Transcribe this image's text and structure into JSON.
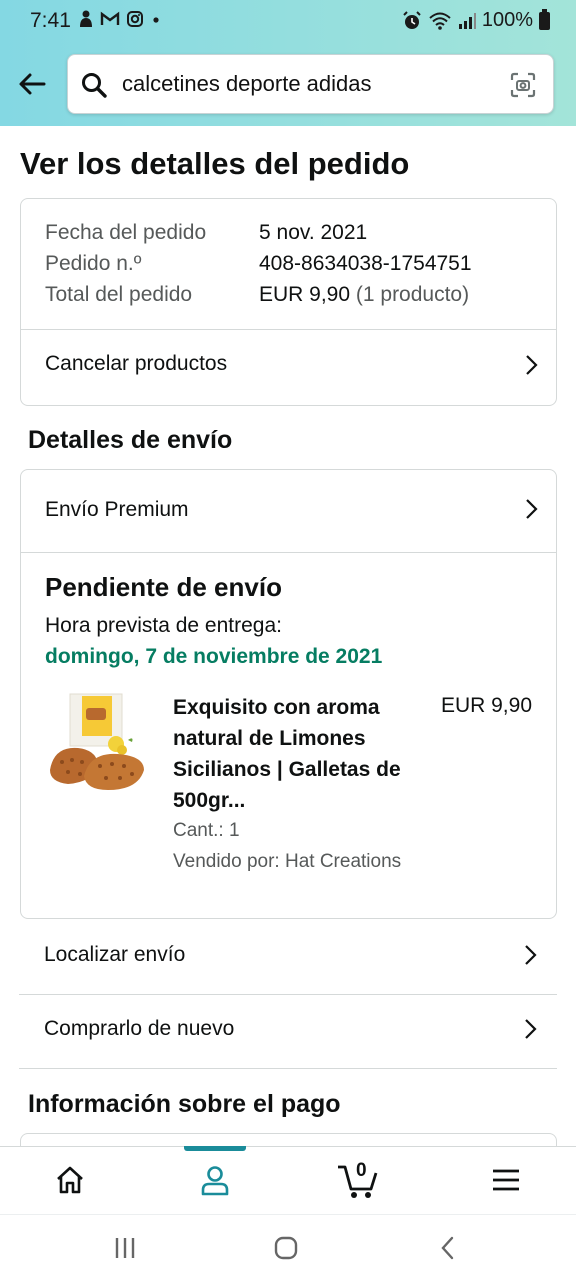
{
  "status_bar": {
    "time": "7:41",
    "battery": "100%"
  },
  "search": {
    "query": "calcetines deporte adidas"
  },
  "page": {
    "title": "Ver los detalles del pedido"
  },
  "order_summary": {
    "rows": [
      {
        "label": "Fecha del pedido",
        "value": "5 nov. 2021",
        "extra": ""
      },
      {
        "label": "Pedido n.º",
        "value": "408-8634038-1754751",
        "extra": ""
      },
      {
        "label": "Total del pedido",
        "value": "EUR 9,90",
        "extra": " (1 producto)"
      }
    ],
    "cancel_label": "Cancelar productos"
  },
  "shipping": {
    "section_title": "Detalles de envío",
    "method_label": "Envío Premium",
    "status_title": "Pendiente de envío",
    "eta_label": "Hora prevista de entrega:",
    "eta_date": "domingo, 7 de noviembre de 2021",
    "product": {
      "name": "Exquisito con aroma natural de Limones Sicilianos | Galletas de 500gr...",
      "price": "EUR 9,90",
      "quantity": "Cant.: 1",
      "seller": "Vendido por: Hat Creations"
    }
  },
  "actions": {
    "track_label": "Localizar envío",
    "buy_again_label": "Comprarlo de nuevo"
  },
  "payment": {
    "section_title": "Información sobre el pago"
  },
  "bottom_nav": {
    "cart_count": "0",
    "active": "account"
  },
  "colors": {
    "accent_green": "#067d62",
    "nav_indicator": "#1a8c9a",
    "header_gradient_start": "#84d8e3",
    "header_gradient_end": "#a3e4d9"
  }
}
